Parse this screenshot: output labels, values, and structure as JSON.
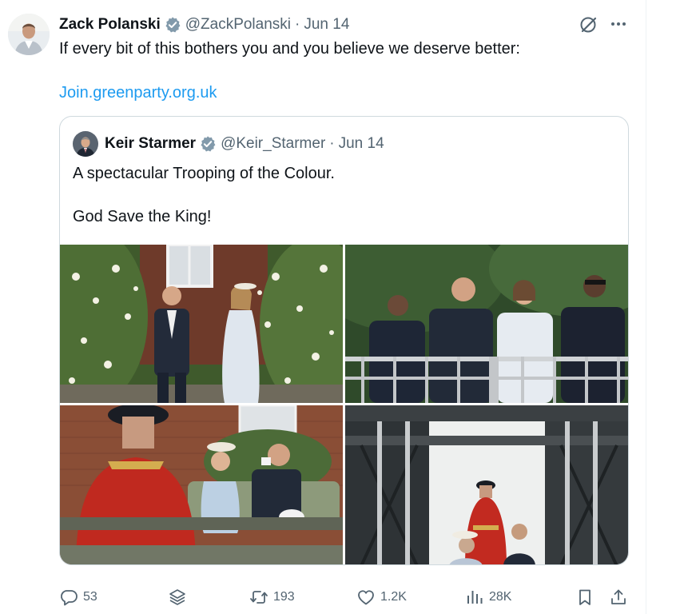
{
  "tweet": {
    "author_name": "Zack Polanski",
    "handle": "@ZackPolanski",
    "separator": "·",
    "date": "Jun 14",
    "text": "If every bit of this bothers you and you believe we deserve better:",
    "link": "Join.greenparty.org.uk"
  },
  "quote": {
    "author_name": "Keir Starmer",
    "handle": "@Keir_Starmer",
    "separator": "·",
    "date": "Jun 14",
    "text_line1": "A spectacular Trooping of the Colour.",
    "text_line2": "God Save the King!"
  },
  "actions": {
    "reply_count": "53",
    "retweet_count": "193",
    "like_count": "1.2K",
    "view_count": "28K"
  },
  "colors": {
    "accent": "#1d9bf0",
    "verified": "#829aab",
    "muted_text": "#536471",
    "border": "#cfd9de"
  },
  "icons": [
    "verified-badge-icon",
    "grok-icon",
    "more-icon",
    "reply-icon",
    "stack-icon",
    "retweet-icon",
    "like-icon",
    "views-icon",
    "bookmark-icon",
    "share-icon"
  ]
}
